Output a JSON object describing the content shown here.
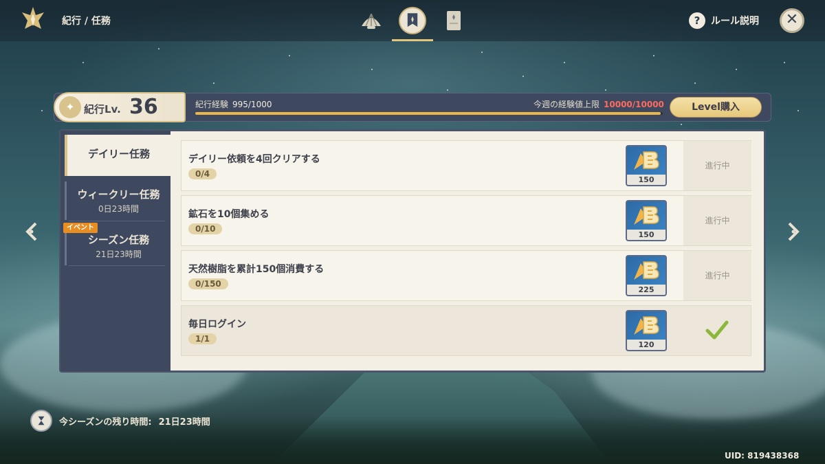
{
  "header": {
    "breadcrumb": "紀行 / 任務",
    "rules_label": "ルール説明",
    "tabs": [
      {
        "icon": "shell-icon",
        "active": false
      },
      {
        "icon": "banner-icon",
        "active": true
      },
      {
        "icon": "scroll-icon",
        "active": false
      }
    ]
  },
  "level": {
    "label": "紀行Lv.",
    "value": "36",
    "exp_label": "紀行経験",
    "exp_value": "995/1000",
    "exp_progress": 0.995,
    "weekly_label": "今週の経験値上限",
    "weekly_value": "10000/10000",
    "buy_label": "Level購入"
  },
  "sidebar": {
    "daily": {
      "label": "デイリー任務"
    },
    "weekly": {
      "label": "ウィークリー任務",
      "timer": "0日23時間"
    },
    "season": {
      "label": "シーズン任務",
      "timer": "21日23時間",
      "badge": "イベント"
    }
  },
  "tasks": [
    {
      "title": "デイリー依頼を4回クリアする",
      "progress": "0/4",
      "reward": "150",
      "status": "進行中"
    },
    {
      "title": "鉱石を10個集める",
      "progress": "0/10",
      "reward": "150",
      "status": "進行中"
    },
    {
      "title": "天然樹脂を累計150個消費する",
      "progress": "0/150",
      "reward": "225",
      "status": "進行中"
    },
    {
      "title": "毎日ログイン",
      "progress": "1/1",
      "reward": "120",
      "status": "",
      "completed": true
    }
  ],
  "footer": {
    "season_label": "今シーズンの残り時間:",
    "season_value": "21日23時間",
    "uid": "UID: 819438368"
  },
  "colors": {
    "accent_gold": "#e3c57c",
    "panel_bg": "#f3efe5",
    "sidebar_bg": "#3e4960",
    "limit_red": "#ff6b5d",
    "check_green": "#8bb83a"
  }
}
